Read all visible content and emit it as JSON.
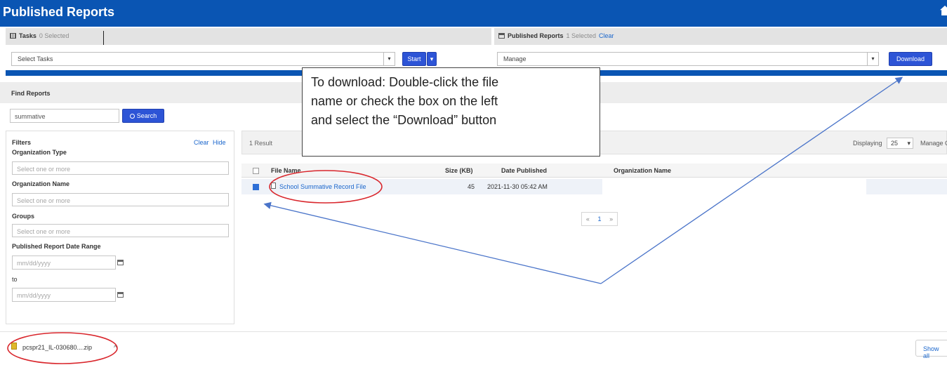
{
  "header": {
    "title": "Published Reports",
    "home_icon": "home-icon"
  },
  "tasks_panel": {
    "label": "Tasks",
    "selected_text": "0 Selected",
    "select_value": "Select Tasks",
    "start_button": "Start",
    "caret": "▾"
  },
  "reports_panel": {
    "label": "Published Reports",
    "selected_text": "1 Selected",
    "clear_link": "Clear",
    "select_value": "Manage",
    "download_button": "Download"
  },
  "find_reports": {
    "label": "Find Reports",
    "search_value": "summative",
    "search_button": "Search"
  },
  "filters": {
    "title": "Filters",
    "clear_link": "Clear",
    "hide_link": "Hide",
    "org_type_label": "Organization Type",
    "org_type_placeholder": "Select one or more",
    "org_name_label": "Organization Name",
    "org_name_placeholder": "Select one or more",
    "groups_label": "Groups",
    "groups_placeholder": "Select one or more",
    "date_range_label": "Published Report Date Range",
    "from_placeholder": "mm/dd/yyyy",
    "to_label": "to",
    "to_placeholder": "mm/dd/yyyy"
  },
  "results": {
    "count_text": "1 Result",
    "displaying_label": "Displaying",
    "page_size": "25",
    "manage_columns": "Manage Columns",
    "columns": [
      "File Name",
      "Size (KB)",
      "Date Published",
      "Organization Name"
    ],
    "rows": [
      {
        "file_name": "School Summative Record File",
        "size": "45",
        "date": "2021-11-30 05:42 AM",
        "org": "",
        "checked": true
      }
    ],
    "pager": {
      "prev": "«",
      "page": "1",
      "next": "»"
    }
  },
  "callout": {
    "lines": [
      "To download: Double-click the file",
      "name or check the box on the left",
      "and select the “Download” button"
    ]
  },
  "download_bar": {
    "file_name": "pcspr21_IL-030680....zip",
    "chevron": "^",
    "show_all": "Show all"
  },
  "colors": {
    "header_blue": "#0a55b3",
    "button_blue": "#2d54d6",
    "link_blue": "#1a66cc",
    "annotation_red": "#d9262c",
    "annotation_arrow": "#4a74c9"
  }
}
